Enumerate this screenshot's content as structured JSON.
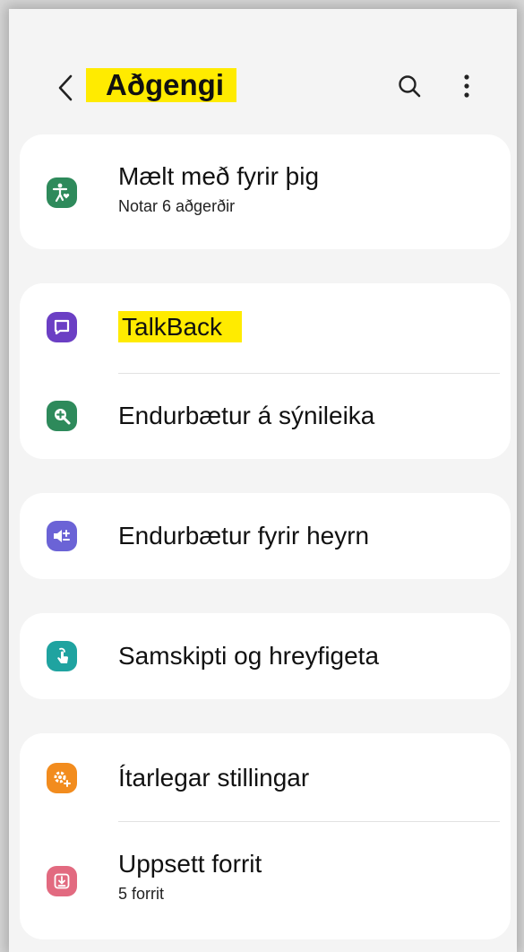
{
  "header": {
    "title": "Aðgengi",
    "back_icon": "chevron-left-icon",
    "search_icon": "search-icon",
    "more_icon": "more-vertical-icon"
  },
  "items": {
    "recommended": {
      "title": "Mælt með fyrir þig",
      "subtitle": "Notar 6 aðgerðir",
      "icon": "accessibility-person-icon",
      "color": "#2e8a5b"
    },
    "talkback": {
      "title": "TalkBack",
      "icon": "talkback-bubble-icon",
      "color": "#6b3fc4"
    },
    "visibility": {
      "title": "Endurbætur á sýnileika",
      "icon": "magnifier-plus-icon",
      "color": "#2e8a5b"
    },
    "hearing": {
      "title": "Endurbætur fyrir heyrn",
      "icon": "hearing-volume-icon",
      "color": "#6b63d6"
    },
    "interaction": {
      "title": "Samskipti og hreyfigeta",
      "icon": "touch-hand-icon",
      "color": "#1fa3a0"
    },
    "advanced": {
      "title": "Ítarlegar stillingar",
      "icon": "advanced-settings-icon",
      "color": "#f28c1e"
    },
    "installed": {
      "title": "Uppsett forrit",
      "subtitle": "5 forrit",
      "icon": "download-app-icon",
      "color": "#e26a80"
    }
  },
  "colors": {
    "highlight": "#ffeb00",
    "background": "#f4f4f4",
    "card": "#ffffff"
  }
}
